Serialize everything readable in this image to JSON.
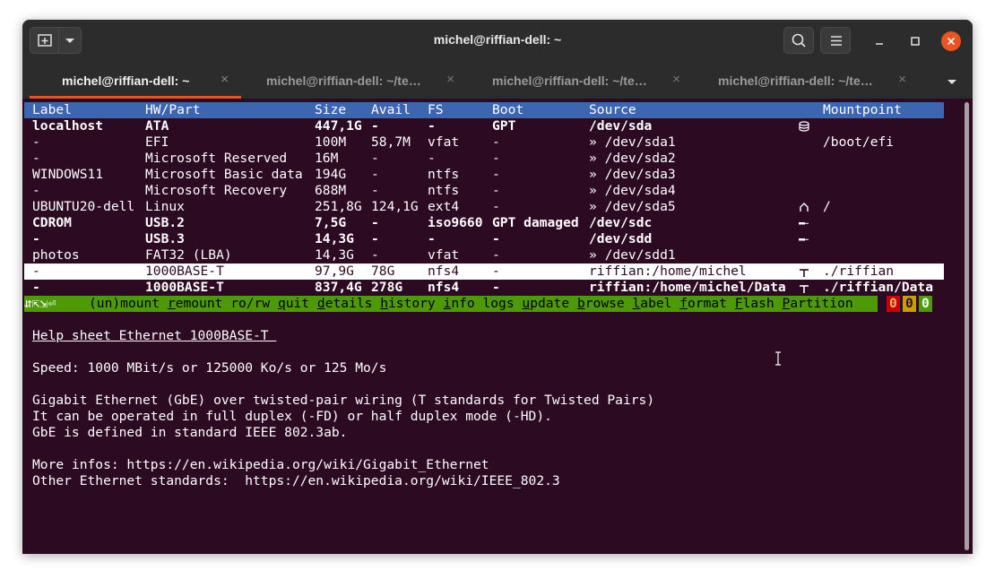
{
  "window": {
    "title": "michel@riffian-dell: ~"
  },
  "tabs": [
    {
      "label": "michel@riffian-dell: ~",
      "active": true
    },
    {
      "label": "michel@riffian-dell: ~/te…",
      "active": false
    },
    {
      "label": "michel@riffian-dell: ~/te…",
      "active": false
    },
    {
      "label": "michel@riffian-dell: ~/te…",
      "active": false
    }
  ],
  "tab_close_glyph": "×",
  "table": {
    "headers": {
      "label": "Label",
      "hw": "HW/Part",
      "size": "Size",
      "avail": "Avail",
      "fs": "FS",
      "boot": "Boot",
      "source": "Source",
      "mountpoint": "Mountpoint"
    },
    "rows": [
      {
        "label": "localhost",
        "hw": "ATA",
        "size": "447,1G",
        "avail": "-",
        "fs": "-",
        "boot": "GPT",
        "source": "/dev/sda",
        "icon": "disk-icon",
        "mountpoint": "",
        "bold": true
      },
      {
        "label": "-",
        "hw": "EFI",
        "size": "100M",
        "avail": "58,7M",
        "fs": "vfat",
        "boot": "-",
        "source": "» /dev/sda1",
        "icon": "",
        "mountpoint": "/boot/efi",
        "bold": false
      },
      {
        "label": "-",
        "hw": "Microsoft Reserved",
        "size": "16M",
        "avail": "-",
        "fs": "-",
        "boot": "-",
        "source": "» /dev/sda2",
        "icon": "",
        "mountpoint": "",
        "bold": false
      },
      {
        "label": "WINDOWS11",
        "hw": "Microsoft Basic data",
        "size": "194G",
        "avail": "-",
        "fs": "ntfs",
        "boot": "-",
        "source": "» /dev/sda3",
        "icon": "",
        "mountpoint": "",
        "bold": false
      },
      {
        "label": "-",
        "hw": "Microsoft Recovery",
        "size": "688M",
        "avail": "-",
        "fs": "ntfs",
        "boot": "-",
        "source": "» /dev/sda4",
        "icon": "",
        "mountpoint": "",
        "bold": false
      },
      {
        "label": "UBUNTU20-dell",
        "hw": "Linux",
        "size": "251,8G",
        "avail": "124,1G",
        "fs": "ext4",
        "boot": "-",
        "source": "» /dev/sda5",
        "icon": "home-icon",
        "mountpoint": "/",
        "bold": false
      },
      {
        "label": "CDROM",
        "hw": "USB.2",
        "size": "7,5G",
        "avail": "-",
        "fs": "iso9660",
        "boot": "GPT damaged",
        "source": "/dev/sdc",
        "icon": "usb-icon",
        "mountpoint": "",
        "bold": true
      },
      {
        "label": "-",
        "hw": "USB.3",
        "size": "14,3G",
        "avail": "-",
        "fs": "-",
        "boot": "-",
        "source": "/dev/sdd",
        "icon": "usb-icon",
        "mountpoint": "",
        "bold": true
      },
      {
        "label": "photos",
        "hw": "FAT32 (LBA)",
        "size": "14,3G",
        "avail": "-",
        "fs": "vfat",
        "boot": "-",
        "source": "» /dev/sdd1",
        "icon": "",
        "mountpoint": "",
        "bold": false
      },
      {
        "label": "-",
        "hw": "1000BASE-T",
        "size": "97,9G",
        "avail": "78G",
        "fs": "nfs4",
        "boot": "-",
        "source": "riffian:/home/michel",
        "icon": "network-icon",
        "mountpoint": "./riffian",
        "bold": false,
        "selected": true
      },
      {
        "label": "-",
        "hw": "1000BASE-T",
        "size": "837,4G",
        "avail": "278G",
        "fs": "nfs4",
        "boot": "-",
        "source": "riffian:/home/michel/Data",
        "icon": "network-icon",
        "mountpoint": "./riffian/Data",
        "bold": true
      }
    ]
  },
  "menu": {
    "arrows": "⇵⇱⇲⏎",
    "items": [
      {
        "pre": "(un)",
        "key": "",
        "rest": "mount"
      },
      {
        "pre": "",
        "key": "r",
        "rest": "emount"
      },
      {
        "pre": "",
        "key": "",
        "rest": "ro/rw"
      },
      {
        "pre": "",
        "key": "q",
        "rest": "uit"
      },
      {
        "pre": "",
        "key": "d",
        "rest": "etails"
      },
      {
        "pre": "",
        "key": "h",
        "rest": "istory"
      },
      {
        "pre": "",
        "key": "i",
        "rest": "nfo"
      },
      {
        "pre": "",
        "key": "",
        "rest": "logs"
      },
      {
        "pre": "",
        "key": "u",
        "rest": "pdate"
      },
      {
        "pre": "",
        "key": "b",
        "rest": "rowse"
      },
      {
        "pre": "",
        "key": "l",
        "rest": "abel"
      },
      {
        "pre": "",
        "key": "f",
        "rest": "ormat"
      },
      {
        "pre": "",
        "key": "F",
        "rest": "lash"
      },
      {
        "pre": "",
        "key": "P",
        "rest": "artition"
      }
    ],
    "indicators": [
      {
        "value": "0",
        "color": "#cc0000",
        "text_color": "#e9b96e"
      },
      {
        "value": "0",
        "color": "#c4a000",
        "text_color": "#2c0a22"
      },
      {
        "value": "0",
        "color": "#4e9a06",
        "text_color": "#ffffff"
      }
    ]
  },
  "help": {
    "heading": "Help sheet Ethernet 1000BASE-T ",
    "speed": "Speed: 1000 MBit/s or 125000 Ko/s or 125 Mo/s",
    "line1": "Gigabit Ethernet (GbE) over twisted-pair wiring (T standards for Twisted Pairs)",
    "line2": "It can be operated in full duplex (-FD) or half duplex mode (-HD).",
    "line3": "GbE is defined in standard IEEE 802.3ab.",
    "more": "More infos: https://en.wikipedia.org/wiki/Gigabit_Ethernet",
    "other": "Other Ethernet standards:  https://en.wikipedia.org/wiki/IEEE_802.3"
  }
}
